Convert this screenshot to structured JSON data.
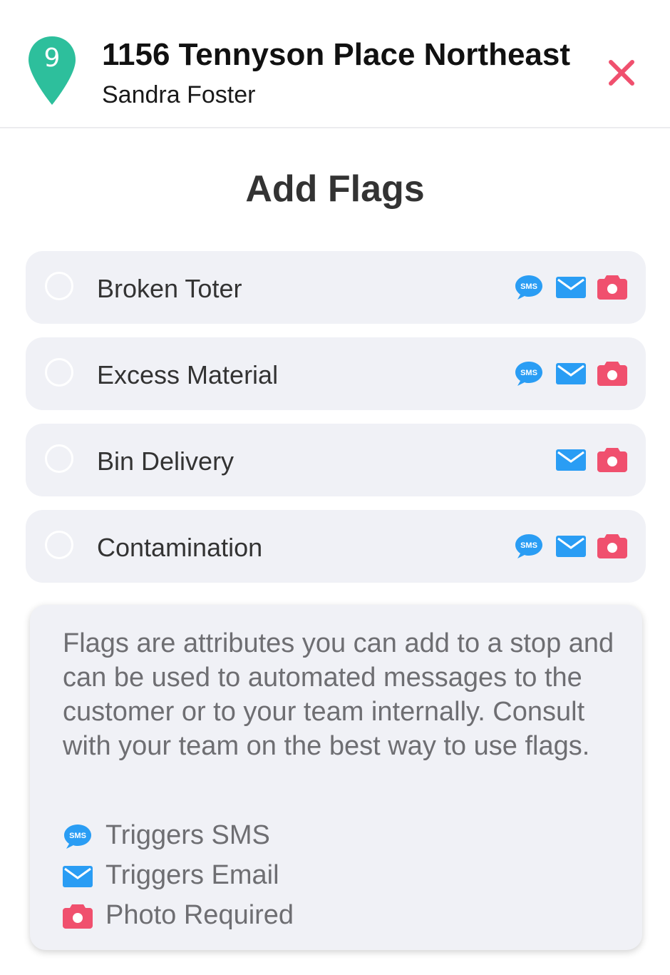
{
  "header": {
    "stop_number": "9",
    "address": "1156 Tennyson Place Northeast",
    "customer_name": "Sandra Foster",
    "pin_icon": "map-pin-icon",
    "close_icon": "close-icon"
  },
  "page": {
    "heading": "Add Flags"
  },
  "flags": [
    {
      "label": "Broken Toter",
      "selected": false,
      "triggers_sms": true,
      "triggers_email": true,
      "photo_required": true
    },
    {
      "label": "Excess Material",
      "selected": false,
      "triggers_sms": true,
      "triggers_email": true,
      "photo_required": true
    },
    {
      "label": "Bin Delivery",
      "selected": false,
      "triggers_sms": false,
      "triggers_email": true,
      "photo_required": true
    },
    {
      "label": "Contamination",
      "selected": false,
      "triggers_sms": true,
      "triggers_email": true,
      "photo_required": true
    }
  ],
  "info": {
    "description": "Flags are attributes you can add to a stop and can be used to automated messages to the customer or to your team internally. Consult with your team on the best way to use flags.",
    "legend": [
      {
        "icon": "sms-bubble-icon",
        "label": "Triggers SMS"
      },
      {
        "icon": "email-icon",
        "label": "Triggers Email"
      },
      {
        "icon": "camera-icon",
        "label": "Photo Required"
      }
    ]
  },
  "icon_text": {
    "sms": "SMS"
  },
  "colors": {
    "pin": "#2dbf9c",
    "close": "#f0506e",
    "sms": "#2a9df4",
    "email": "#2a9df4",
    "camera": "#f0506e",
    "row_bg": "#f0f1f6"
  }
}
